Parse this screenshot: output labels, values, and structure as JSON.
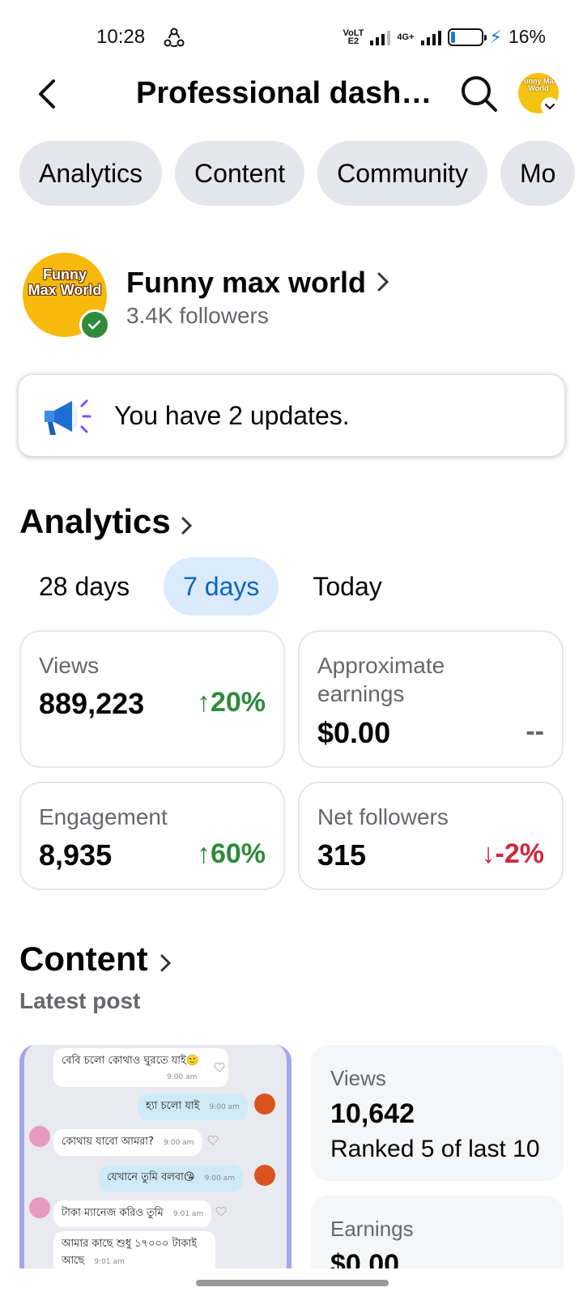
{
  "status_bar": {
    "time": "10:28",
    "network_1": "VoLTE2",
    "network_2": "4G+",
    "battery_percent": "16%",
    "battery_level": 0.16
  },
  "header": {
    "title": "Professional dashb…",
    "back_icon": "chevron-left-icon",
    "search_icon": "search-icon",
    "avatar_logo_text": "Funny Max World"
  },
  "tabs": [
    "Analytics",
    "Content",
    "Community",
    "Mo"
  ],
  "profile": {
    "name": "Funny max world",
    "followers": "3.4K followers",
    "logo_text": "Funny Max World",
    "verified": true
  },
  "updates": {
    "text": "You have 2 updates.",
    "icon": "megaphone-icon"
  },
  "analytics": {
    "title": "Analytics",
    "ranges": [
      "28 days",
      "7 days",
      "Today"
    ],
    "active_range": "7 days",
    "metrics": {
      "views": {
        "label": "Views",
        "value": "889,223",
        "change": "20%",
        "direction": "up"
      },
      "earnings": {
        "label": "Approximate earnings",
        "value": "$0.00",
        "change": "--",
        "direction": "none"
      },
      "engagement": {
        "label": "Engagement",
        "value": "8,935",
        "change": "60%",
        "direction": "up"
      },
      "net_followers": {
        "label": "Net followers",
        "value": "315",
        "change": "-2%",
        "direction": "down"
      }
    }
  },
  "content": {
    "title": "Content",
    "latest_label": "Latest post",
    "post_chat": [
      {
        "side": "left",
        "text": "বেবি চলো কোথাও ঘুরতে যাই🙂",
        "time": "9:00 am"
      },
      {
        "side": "right",
        "text": "হ্যা চলো যাই",
        "time": "9:00 am"
      },
      {
        "side": "left",
        "text": "কোথায় যাবো আমরা?",
        "time": "9:00 am"
      },
      {
        "side": "right",
        "text": "যেখানে তুমি বলবা😘",
        "time": "9:00 am"
      },
      {
        "side": "left",
        "text": "টাকা ম্যানেজ করিও তুমি",
        "time": "9:01 am"
      },
      {
        "side": "left",
        "text": "আমার কাছে শুধু ১৭০০০ টাকাই আছে",
        "time": "9:01 am"
      }
    ],
    "stats": {
      "views_label": "Views",
      "views_value": "10,642",
      "rank": "Ranked 5 of last 10",
      "earnings_label": "Earnings",
      "earnings_value": "$0.00"
    }
  },
  "colors": {
    "accent": "#0a66c2",
    "positive": "#2e8b3a",
    "negative": "#d0263b",
    "chip_bg": "#e4e6eb",
    "logo_yellow": "#f6b90c"
  }
}
